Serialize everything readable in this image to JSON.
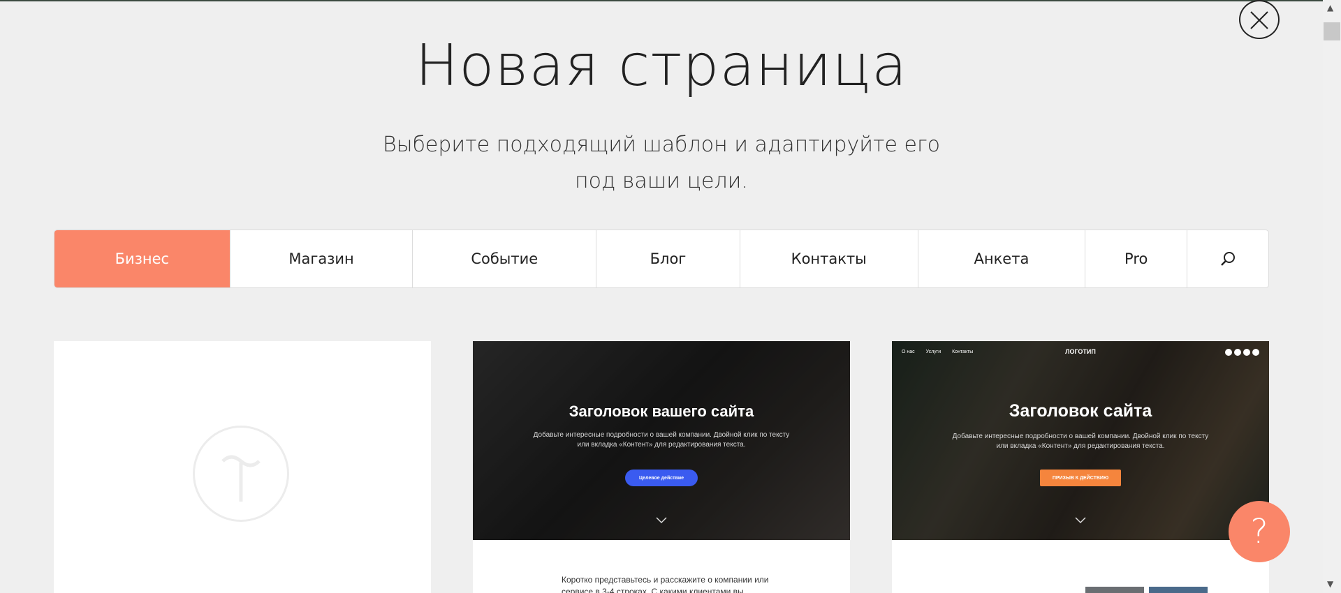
{
  "header": {
    "title": "Новая страница",
    "subtitle": "Выберите подходящий шаблон и адаптируйте его под ваши цели."
  },
  "close_icon": "close-icon",
  "tabs": [
    {
      "label": "Бизнес",
      "active": true
    },
    {
      "label": "Магазин",
      "active": false
    },
    {
      "label": "Событие",
      "active": false
    },
    {
      "label": "Блог",
      "active": false
    },
    {
      "label": "Контакты",
      "active": false
    },
    {
      "label": "Анкета",
      "active": false
    },
    {
      "label": "Pro",
      "active": false
    }
  ],
  "search_icon": "search-icon",
  "templates": [
    {
      "kind": "blank",
      "icon": "tilda-logo-icon"
    },
    {
      "hero_title": "Заголовок вашего сайта",
      "hero_text": "Добавьте интересные подробности о вашей компании. Двойной клик по тексту или вкладка «Контент» для редактирования текста.",
      "button": "Целевое действие",
      "intro": "Коротко представьтесь и расскажите о компании или сервисе в 3-4 строках. С какими клиентами вы"
    },
    {
      "nav": [
        "О нас",
        "Услуги",
        "Контакты"
      ],
      "logo": "ЛОГОТИП",
      "hero_title": "Заголовок сайта",
      "hero_text": "Добавьте интересные подробности о вашей компании. Двойной клик по тексту или вкладка «Контент» для редактирования текста.",
      "button": "ПРИЗЫВ К ДЕЙСТВИЮ"
    }
  ],
  "help": {
    "label": "?"
  },
  "colors": {
    "accent": "#fa8669",
    "cta_blue": "#3a5bf0",
    "cta_orange": "#f5853d"
  }
}
